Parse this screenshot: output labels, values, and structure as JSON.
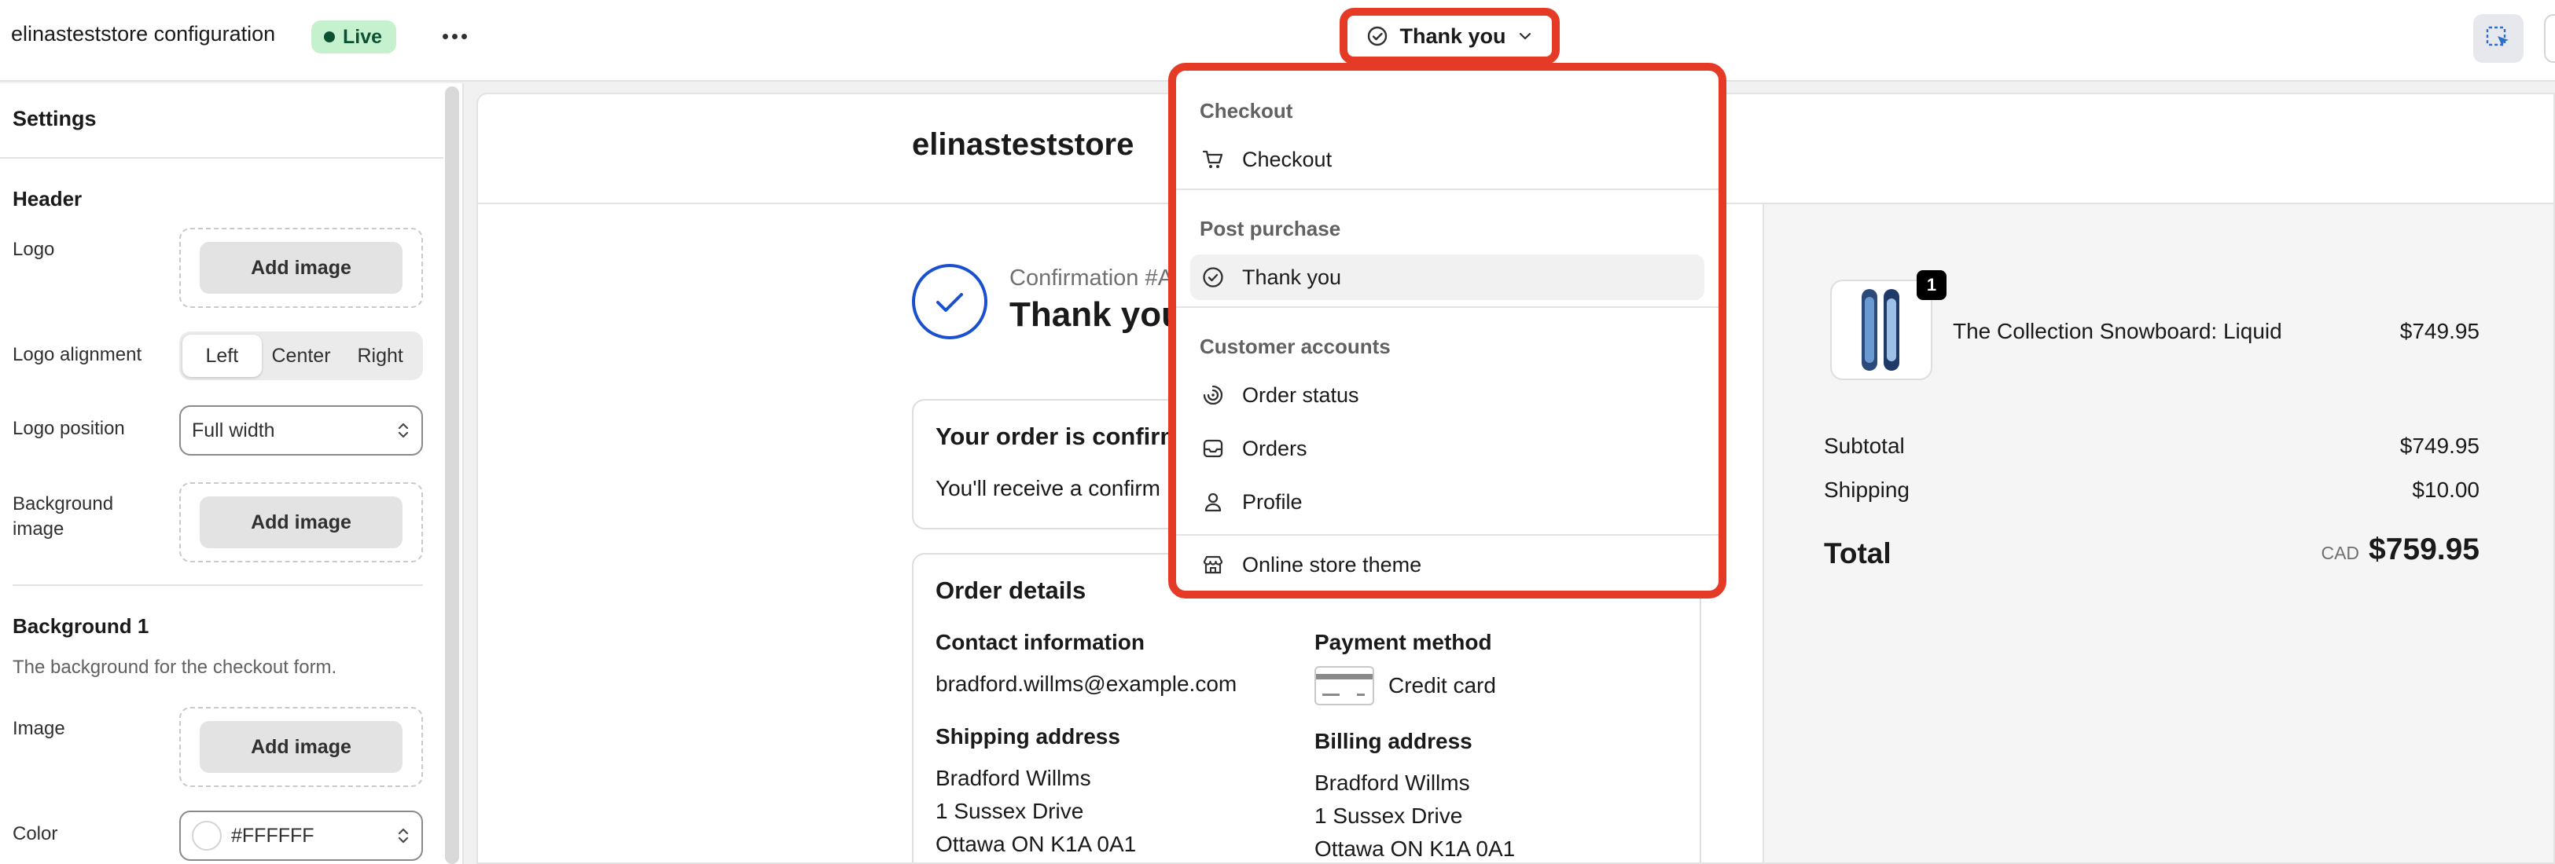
{
  "topbar": {
    "app_title": "elinasteststore configuration",
    "status_badge": "Live",
    "page_selector": "Thank you"
  },
  "sidebar": {
    "title": "Settings",
    "header_section": "Header",
    "logo_label": "Logo",
    "add_image": "Add image",
    "logo_alignment_label": "Logo alignment",
    "alignment_options": [
      "Left",
      "Center",
      "Right"
    ],
    "alignment_selected": "Left",
    "logo_position_label": "Logo position",
    "logo_position_value": "Full width",
    "background_image_label": "Background image",
    "background1_section": "Background 1",
    "background1_help": "The background for the checkout form.",
    "image_label": "Image",
    "color_label": "Color",
    "color_value": "#FFFFFF"
  },
  "preview": {
    "store_name": "elinasteststore",
    "confirmation": "Confirmation #A",
    "thanks": "Thank you,",
    "confirmed_card": {
      "title": "Your order is confirm",
      "text": "You'll receive a confirm"
    },
    "order_details": {
      "title": "Order details",
      "contact_heading": "Contact information",
      "contact_email": "bradford.willms@example.com",
      "payment_heading": "Payment method",
      "payment_value": "Credit card",
      "shipping_heading": "Shipping address",
      "shipping_lines": [
        "Bradford Willms",
        "1 Sussex Drive",
        "Ottawa ON K1A 0A1"
      ],
      "billing_heading": "Billing address",
      "billing_lines": [
        "Bradford Willms",
        "1 Sussex Drive",
        "Ottawa ON K1A 0A1"
      ]
    },
    "summary": {
      "item_qty": "1",
      "item_name": "The Collection Snowboard: Liquid",
      "item_price": "$749.95",
      "subtotal_label": "Subtotal",
      "subtotal_value": "$749.95",
      "shipping_label": "Shipping",
      "shipping_value": "$10.00",
      "total_label": "Total",
      "currency": "CAD",
      "total_value": "$759.95"
    }
  },
  "dropdown": {
    "section_checkout": "Checkout",
    "item_checkout": "Checkout",
    "section_post_purchase": "Post purchase",
    "item_thank_you": "Thank you",
    "section_customer_accounts": "Customer accounts",
    "item_order_status": "Order status",
    "item_orders": "Orders",
    "item_profile": "Profile",
    "item_online_store_theme": "Online store theme",
    "selected_item": "Thank you"
  },
  "colors": {
    "highlight": "#e53a26",
    "live_badge_bg": "#c6f1cf",
    "confirm_accent": "#1a4fd0"
  }
}
